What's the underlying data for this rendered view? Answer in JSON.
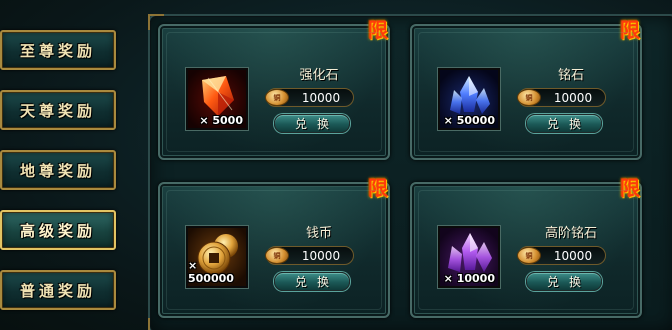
{
  "tabs": [
    {
      "label": "至尊奖励",
      "active": false
    },
    {
      "label": "天尊奖励",
      "active": false
    },
    {
      "label": "地尊奖励",
      "active": false
    },
    {
      "label": "高级奖励",
      "active": true
    },
    {
      "label": "普通奖励",
      "active": false
    }
  ],
  "limit_badge": "限",
  "currency_icon": "coin-icon",
  "coin_glyph": "铜",
  "exchange_label": "兑换",
  "cards": [
    {
      "name": "强化石",
      "quantity": "× 5000",
      "price": "10000",
      "icon": "red-crystal-icon"
    },
    {
      "name": "铭石",
      "quantity": "× 50000",
      "price": "10000",
      "icon": "blue-crystal-icon"
    },
    {
      "name": "钱币",
      "quantity": "× 500000",
      "price": "10000",
      "icon": "coin-stack-icon"
    },
    {
      "name": "高阶铭石",
      "quantity": "× 10000",
      "price": "10000",
      "icon": "purple-crystal-icon"
    }
  ],
  "colors": {
    "accent_gold": "#a98a3e",
    "limit_red": "#ff3b0a",
    "panel_teal": "#1a3f40"
  }
}
